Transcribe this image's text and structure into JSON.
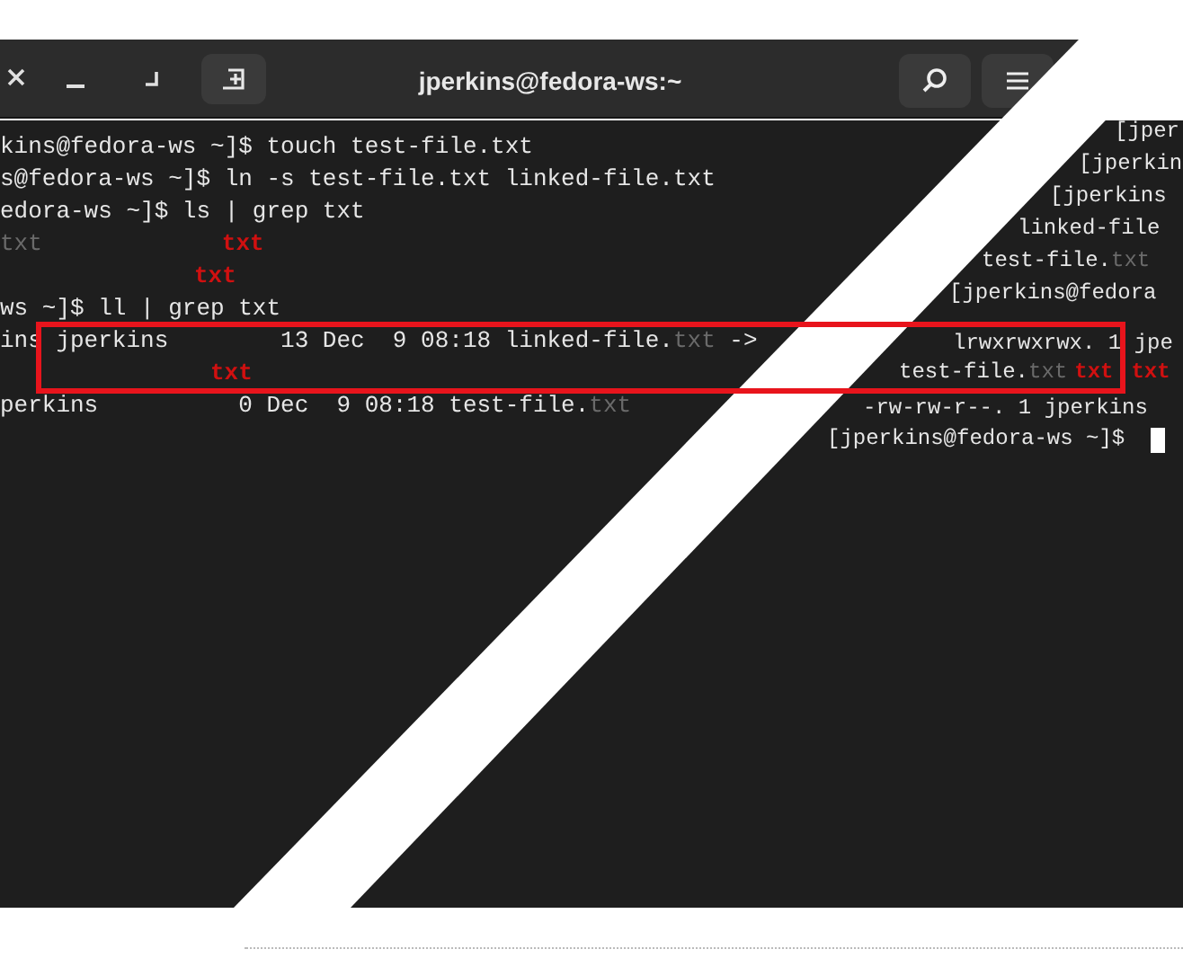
{
  "window": {
    "title": "jperkins@fedora-ws:~"
  },
  "terminal": {
    "left_lines": [
      [
        {
          "kind": "plain",
          "text": "kins@fedora-ws ~]$ touch test-file.txt"
        }
      ],
      [
        {
          "kind": "plain",
          "text": "s@fedora-ws ~]$ ln -s test-file.txt linked-file.txt"
        }
      ],
      [
        {
          "kind": "plain",
          "text": "edora-ws ~]$ ls | grep txt"
        }
      ],
      [
        {
          "kind": "dim",
          "text": "txt"
        },
        {
          "kind": "match",
          "text": "txt"
        }
      ],
      [
        {
          "kind": "match",
          "text": "txt"
        }
      ],
      [
        {
          "kind": "plain",
          "text": "ws ~]$ ll | grep txt"
        }
      ],
      [
        {
          "kind": "plain",
          "text": "ins jperkins        13 Dec  9 08:18 linked-file."
        },
        {
          "kind": "dim",
          "text": "txt"
        },
        {
          "kind": "plain",
          "text": " ->"
        }
      ],
      [
        {
          "kind": "match",
          "text": "txt"
        }
      ],
      [
        {
          "kind": "plain",
          "text": "perkins          0 Dec  9 08:18 test-file."
        },
        {
          "kind": "dim",
          "text": "txt"
        }
      ]
    ],
    "right_lines": [
      [
        {
          "kind": "plain",
          "text": "[jper"
        }
      ],
      [
        {
          "kind": "plain",
          "text": "[jperkin"
        }
      ],
      [
        {
          "kind": "plain",
          "text": "[jperkins"
        }
      ],
      [
        {
          "kind": "plain",
          "text": "linked-file"
        }
      ],
      [
        {
          "kind": "plain",
          "text": "test-file."
        },
        {
          "kind": "dim",
          "text": "txt"
        }
      ],
      [
        {
          "kind": "plain",
          "text": "[jperkins@fedora"
        }
      ],
      [
        {
          "kind": "plain",
          "text": "lrwxrwxrwx. 1 jpe"
        }
      ],
      [
        {
          "kind": "plain",
          "text": "test-file."
        },
        {
          "kind": "dim",
          "text": "txt"
        },
        {
          "kind": "match",
          "text": "txt"
        },
        {
          "kind": "match",
          "text": "txt"
        }
      ],
      [
        {
          "kind": "plain",
          "text": "-rw-rw-r--. 1 jperkins"
        }
      ],
      [
        {
          "kind": "plain",
          "text": "[jperkins@fedora-ws ~]$"
        },
        {
          "kind": "cursor"
        }
      ]
    ]
  }
}
